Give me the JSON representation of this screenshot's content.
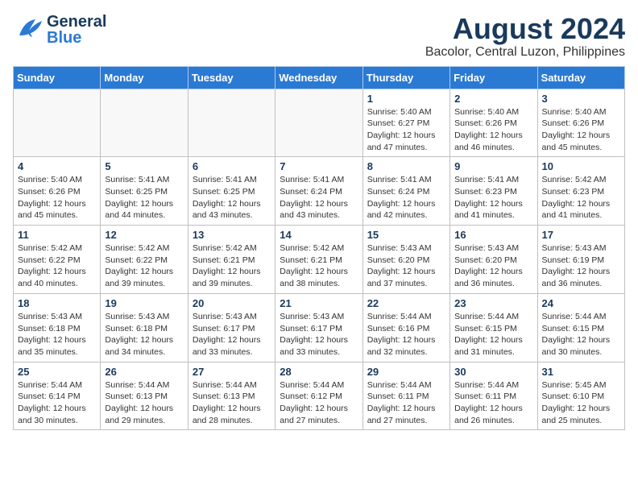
{
  "header": {
    "logo_general": "General",
    "logo_blue": "Blue",
    "title": "August 2024",
    "subtitle": "Bacolor, Central Luzon, Philippines"
  },
  "calendar": {
    "weekdays": [
      "Sunday",
      "Monday",
      "Tuesday",
      "Wednesday",
      "Thursday",
      "Friday",
      "Saturday"
    ],
    "weeks": [
      [
        {
          "day": "",
          "info": ""
        },
        {
          "day": "",
          "info": ""
        },
        {
          "day": "",
          "info": ""
        },
        {
          "day": "",
          "info": ""
        },
        {
          "day": "1",
          "info": "Sunrise: 5:40 AM\nSunset: 6:27 PM\nDaylight: 12 hours\nand 47 minutes."
        },
        {
          "day": "2",
          "info": "Sunrise: 5:40 AM\nSunset: 6:26 PM\nDaylight: 12 hours\nand 46 minutes."
        },
        {
          "day": "3",
          "info": "Sunrise: 5:40 AM\nSunset: 6:26 PM\nDaylight: 12 hours\nand 45 minutes."
        }
      ],
      [
        {
          "day": "4",
          "info": "Sunrise: 5:40 AM\nSunset: 6:26 PM\nDaylight: 12 hours\nand 45 minutes."
        },
        {
          "day": "5",
          "info": "Sunrise: 5:41 AM\nSunset: 6:25 PM\nDaylight: 12 hours\nand 44 minutes."
        },
        {
          "day": "6",
          "info": "Sunrise: 5:41 AM\nSunset: 6:25 PM\nDaylight: 12 hours\nand 43 minutes."
        },
        {
          "day": "7",
          "info": "Sunrise: 5:41 AM\nSunset: 6:24 PM\nDaylight: 12 hours\nand 43 minutes."
        },
        {
          "day": "8",
          "info": "Sunrise: 5:41 AM\nSunset: 6:24 PM\nDaylight: 12 hours\nand 42 minutes."
        },
        {
          "day": "9",
          "info": "Sunrise: 5:41 AM\nSunset: 6:23 PM\nDaylight: 12 hours\nand 41 minutes."
        },
        {
          "day": "10",
          "info": "Sunrise: 5:42 AM\nSunset: 6:23 PM\nDaylight: 12 hours\nand 41 minutes."
        }
      ],
      [
        {
          "day": "11",
          "info": "Sunrise: 5:42 AM\nSunset: 6:22 PM\nDaylight: 12 hours\nand 40 minutes."
        },
        {
          "day": "12",
          "info": "Sunrise: 5:42 AM\nSunset: 6:22 PM\nDaylight: 12 hours\nand 39 minutes."
        },
        {
          "day": "13",
          "info": "Sunrise: 5:42 AM\nSunset: 6:21 PM\nDaylight: 12 hours\nand 39 minutes."
        },
        {
          "day": "14",
          "info": "Sunrise: 5:42 AM\nSunset: 6:21 PM\nDaylight: 12 hours\nand 38 minutes."
        },
        {
          "day": "15",
          "info": "Sunrise: 5:43 AM\nSunset: 6:20 PM\nDaylight: 12 hours\nand 37 minutes."
        },
        {
          "day": "16",
          "info": "Sunrise: 5:43 AM\nSunset: 6:20 PM\nDaylight: 12 hours\nand 36 minutes."
        },
        {
          "day": "17",
          "info": "Sunrise: 5:43 AM\nSunset: 6:19 PM\nDaylight: 12 hours\nand 36 minutes."
        }
      ],
      [
        {
          "day": "18",
          "info": "Sunrise: 5:43 AM\nSunset: 6:18 PM\nDaylight: 12 hours\nand 35 minutes."
        },
        {
          "day": "19",
          "info": "Sunrise: 5:43 AM\nSunset: 6:18 PM\nDaylight: 12 hours\nand 34 minutes."
        },
        {
          "day": "20",
          "info": "Sunrise: 5:43 AM\nSunset: 6:17 PM\nDaylight: 12 hours\nand 33 minutes."
        },
        {
          "day": "21",
          "info": "Sunrise: 5:43 AM\nSunset: 6:17 PM\nDaylight: 12 hours\nand 33 minutes."
        },
        {
          "day": "22",
          "info": "Sunrise: 5:44 AM\nSunset: 6:16 PM\nDaylight: 12 hours\nand 32 minutes."
        },
        {
          "day": "23",
          "info": "Sunrise: 5:44 AM\nSunset: 6:15 PM\nDaylight: 12 hours\nand 31 minutes."
        },
        {
          "day": "24",
          "info": "Sunrise: 5:44 AM\nSunset: 6:15 PM\nDaylight: 12 hours\nand 30 minutes."
        }
      ],
      [
        {
          "day": "25",
          "info": "Sunrise: 5:44 AM\nSunset: 6:14 PM\nDaylight: 12 hours\nand 30 minutes."
        },
        {
          "day": "26",
          "info": "Sunrise: 5:44 AM\nSunset: 6:13 PM\nDaylight: 12 hours\nand 29 minutes."
        },
        {
          "day": "27",
          "info": "Sunrise: 5:44 AM\nSunset: 6:13 PM\nDaylight: 12 hours\nand 28 minutes."
        },
        {
          "day": "28",
          "info": "Sunrise: 5:44 AM\nSunset: 6:12 PM\nDaylight: 12 hours\nand 27 minutes."
        },
        {
          "day": "29",
          "info": "Sunrise: 5:44 AM\nSunset: 6:11 PM\nDaylight: 12 hours\nand 27 minutes."
        },
        {
          "day": "30",
          "info": "Sunrise: 5:44 AM\nSunset: 6:11 PM\nDaylight: 12 hours\nand 26 minutes."
        },
        {
          "day": "31",
          "info": "Sunrise: 5:45 AM\nSunset: 6:10 PM\nDaylight: 12 hours\nand 25 minutes."
        }
      ]
    ]
  }
}
